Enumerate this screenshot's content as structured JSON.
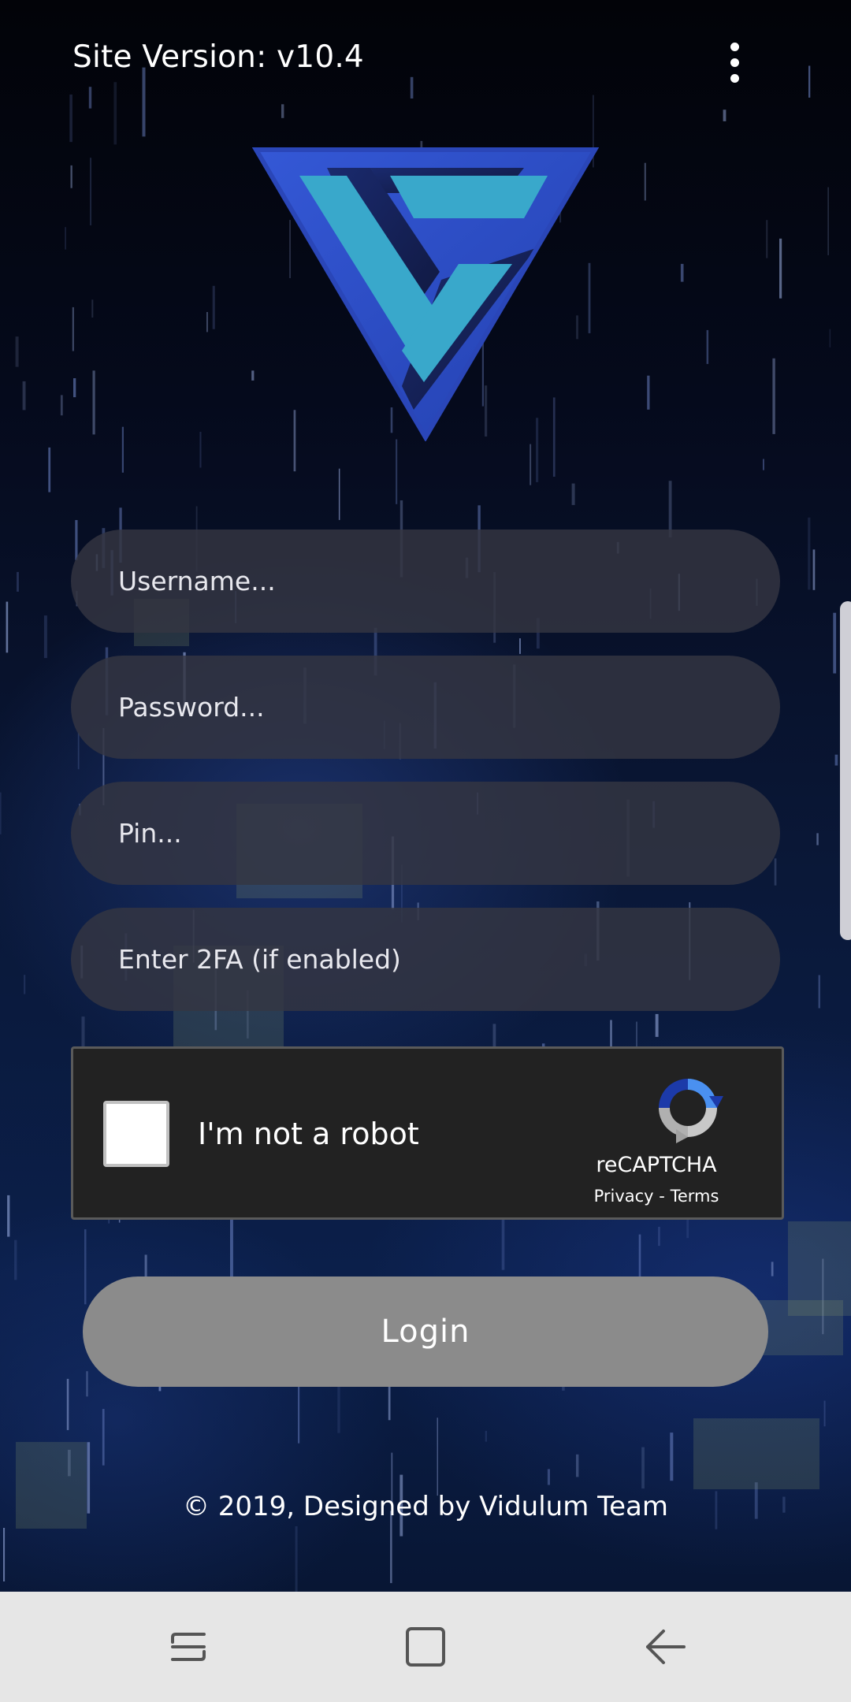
{
  "header": {
    "site_version": "Site Version: v10.4",
    "menu_icon": "more-vert-icon"
  },
  "logo": {
    "icon": "vidulum-logo",
    "colors": {
      "dark_blue": "#2c4fc4",
      "cyan": "#3aa5c8"
    }
  },
  "form": {
    "username_placeholder": "Username...",
    "password_placeholder": "Password...",
    "pin_placeholder": "Pin...",
    "twofa_placeholder": "Enter 2FA (if enabled)"
  },
  "captcha": {
    "label": "I'm not a robot",
    "brand": "reCAPTCHA",
    "privacy": "Privacy",
    "separator": " - ",
    "terms": "Terms",
    "checked": false
  },
  "login_button": {
    "label": "Login",
    "color": "#8b8b8b"
  },
  "footer": {
    "text": "© 2019, Designed by Vidulum Team"
  },
  "navbar": {
    "recent_icon": "recent-apps-icon",
    "home_icon": "home-icon",
    "back_icon": "back-icon"
  }
}
